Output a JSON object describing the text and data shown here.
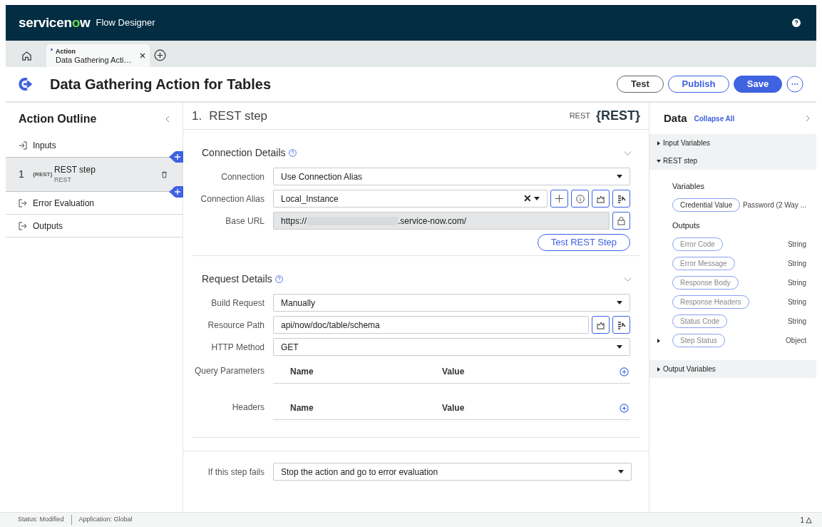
{
  "header": {
    "logo": [
      "servicen",
      "o",
      "w"
    ],
    "product": "Flow Designer"
  },
  "tabs": [
    {
      "modified": true,
      "label": "Action",
      "subtitle": "Data Gathering Acti…",
      "selected": true
    }
  ],
  "title": "Data Gathering Action for Tables",
  "buttons": [
    {
      "label": "Test",
      "kind": "outline"
    },
    {
      "label": "Publish",
      "kind": "secondary"
    },
    {
      "label": "Save",
      "kind": "primary"
    }
  ],
  "outline": {
    "title": "Action Outline",
    "items": [
      {
        "kind": "inputs",
        "label": "Inputs",
        "selected": false
      },
      {
        "kind": "step",
        "number": "1",
        "badge": "{REST}",
        "label": "REST step",
        "sublabel": "REST",
        "selected": true
      },
      {
        "kind": "error",
        "label": "Error Evaluation",
        "selected": false
      },
      {
        "kind": "outputs",
        "label": "Outputs",
        "selected": false
      }
    ]
  },
  "step": {
    "number": "1.",
    "title": "REST step",
    "type": "REST",
    "badge": "{REST}"
  },
  "sections": [
    {
      "title": "Connection Details",
      "expanded": true,
      "fields": [
        {
          "kind": "select",
          "label": "Connection",
          "value": "Use Connection Alias"
        },
        {
          "kind": "reference",
          "label": "Connection Alias",
          "value": "Local_Instance",
          "clear": "✕"
        },
        {
          "kind": "locked",
          "label": "Base URL",
          "prefix": "https://",
          "suffix": ".service-now.com/"
        }
      ],
      "action": "Test REST Step"
    },
    {
      "title": "Request Details",
      "expanded": true,
      "fields": [
        {
          "kind": "select",
          "label": "Build Request",
          "value": "Manually"
        },
        {
          "kind": "text",
          "label": "Resource Path",
          "value": "api/now/doc/table/schema"
        },
        {
          "kind": "select",
          "label": "HTTP Method",
          "value": "GET"
        },
        {
          "kind": "table",
          "label": "Query Parameters",
          "columns": [
            "Name",
            "Value"
          ]
        },
        {
          "kind": "table",
          "label": "Headers",
          "columns": [
            "Name",
            "Value"
          ]
        }
      ]
    }
  ],
  "failure": {
    "label": "If this step fails",
    "value": "Stop the action and go to error evaluation"
  },
  "data": {
    "title": "Data",
    "collapse": "Collapse All",
    "groups": [
      {
        "label": "Input Variables",
        "expanded": false
      },
      {
        "label": "REST step",
        "expanded": true,
        "sections": [
          {
            "title": "Variables",
            "items": [
              {
                "kind": "value",
                "label": "Credential Value",
                "type": "Password (2 Way ..."
              }
            ]
          },
          {
            "title": "Outputs",
            "items": [
              {
                "kind": "output",
                "label": "Error Code",
                "type": "String"
              },
              {
                "kind": "output",
                "label": "Error Message",
                "type": "String"
              },
              {
                "kind": "output",
                "label": "Response Body",
                "type": "String"
              },
              {
                "kind": "output",
                "label": "Response Headers",
                "type": "String"
              },
              {
                "kind": "output",
                "label": "Status Code",
                "type": "String"
              },
              {
                "kind": "expandable",
                "label": "Step Status",
                "type": "Object"
              }
            ]
          }
        ]
      },
      {
        "label": "Output Variables",
        "expanded": false
      }
    ]
  },
  "status_bar": {
    "items": [
      "Status: Modified",
      "Application: Global"
    ],
    "notifications": "1"
  }
}
